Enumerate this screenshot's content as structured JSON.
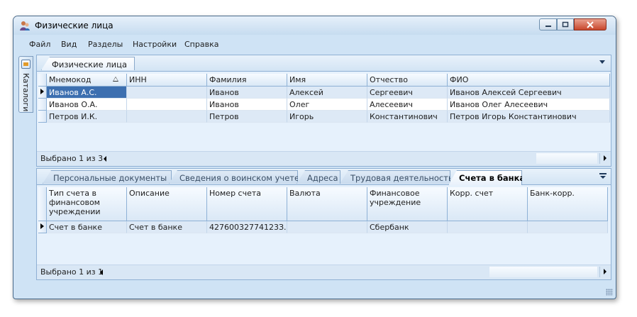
{
  "window": {
    "title": "Физические лица"
  },
  "menu": [
    "Файл",
    "Вид",
    "Разделы",
    "Настройки",
    "Справка"
  ],
  "sidebar": {
    "tab_label": "Каталоги"
  },
  "top_panel": {
    "tab": "Физические лица",
    "columns": [
      "Мнемокод",
      "ИНН",
      "Фамилия",
      "Имя",
      "Отчество",
      "ФИО"
    ],
    "rows": [
      [
        "Иванов А.С.",
        "",
        "Иванов",
        "Алексей",
        "Сергеевич",
        "Иванов Алексей Сергеевич"
      ],
      [
        "Иванов О.А.",
        "",
        "Иванов",
        "Олег",
        "Алесеевич",
        "Иванов Олег Алесеевич"
      ],
      [
        "Петров И.К.",
        "",
        "Петров",
        "Игорь",
        "Константинович",
        "Петров Игорь Константинович"
      ]
    ],
    "status": "Выбрано 1 из 3"
  },
  "bottom_panel": {
    "tabs": [
      "Персональные документы",
      "Сведения о воинском учете",
      "Адреса",
      "Трудовая деятельность",
      "Счета в банках"
    ],
    "active_tab": "Счета в банках",
    "columns": [
      "Тип счета в финансовом учреждении",
      "Описание",
      "Номер счета",
      "Валюта",
      "Финансовое учреждение",
      "Корр. счет",
      "Банк-корр."
    ],
    "rows": [
      [
        "Счет в банке",
        "Счет в банке",
        "42760032774123З...",
        "",
        "Сбербанк",
        "",
        ""
      ]
    ],
    "status": "Выбрано 1 из 1"
  }
}
